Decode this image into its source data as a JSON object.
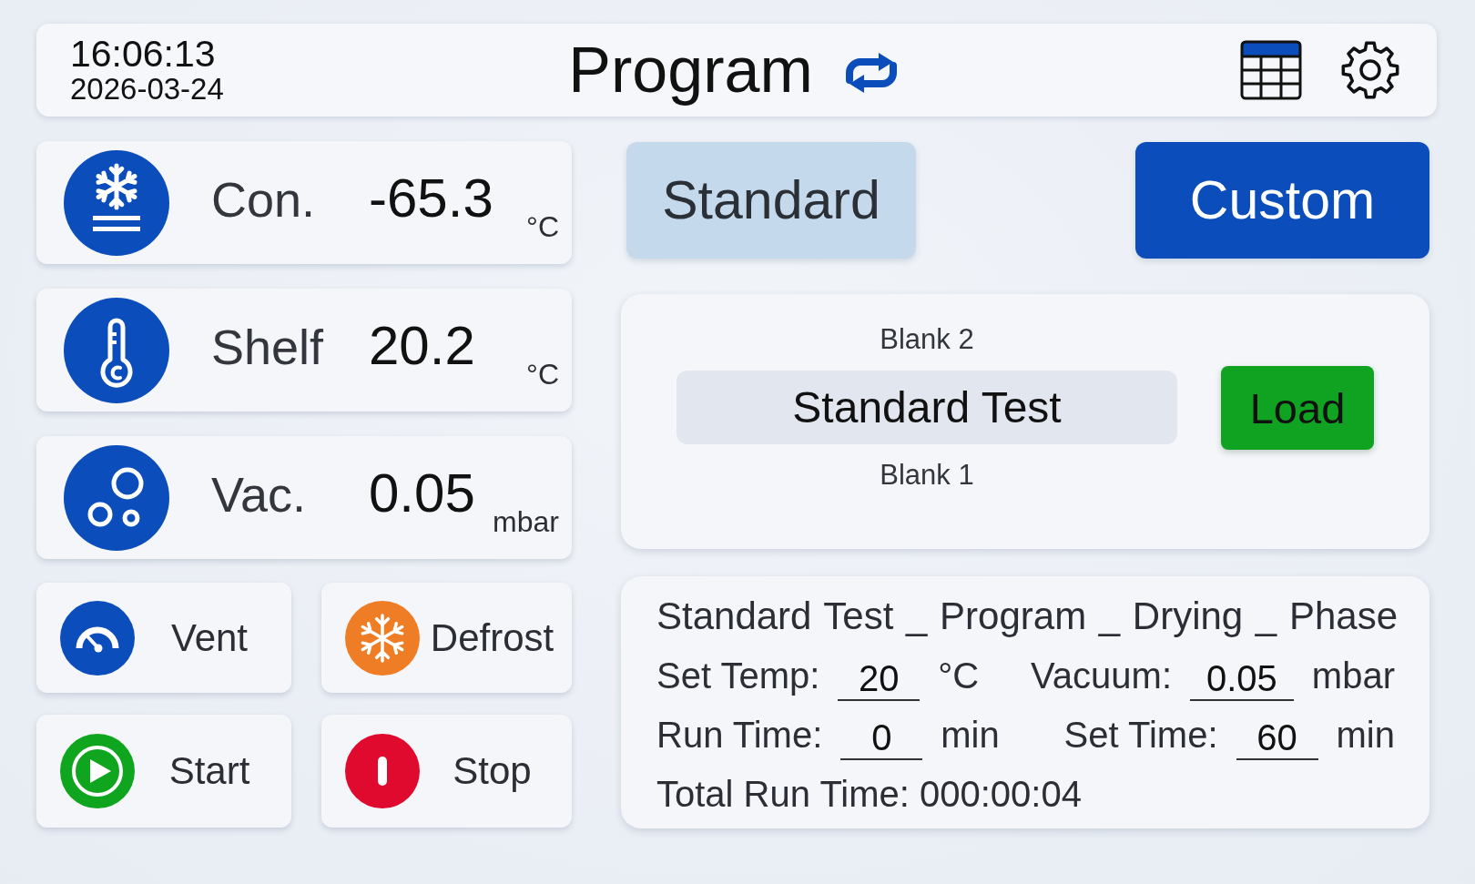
{
  "header": {
    "time": "16:06:13",
    "date": "2026-03-24",
    "title": "Program"
  },
  "sensors": [
    {
      "kind": "condenser",
      "label": "Con.",
      "value": "-65.3",
      "unit": "°C"
    },
    {
      "kind": "shelf",
      "label": "Shelf",
      "value": "20.2",
      "unit": "°C"
    },
    {
      "kind": "vacuum",
      "label": "Vac.",
      "value": "0.05",
      "unit": "mbar"
    }
  ],
  "actions": [
    {
      "kind": "vent",
      "label": "Vent",
      "color": "#0b4dbb"
    },
    {
      "kind": "defrost",
      "label": "Defrost",
      "color": "#ee7d25"
    },
    {
      "kind": "start",
      "label": "Start",
      "color": "#10a51f"
    },
    {
      "kind": "stop",
      "label": "Stop",
      "color": "#e0092e"
    }
  ],
  "mode_tabs": [
    {
      "label": "Standard",
      "selected": false
    },
    {
      "label": "Custom",
      "selected": true
    }
  ],
  "program_list": {
    "items": [
      {
        "label": "Blank 2",
        "selected": false
      },
      {
        "label": "Standard Test",
        "selected": true
      },
      {
        "label": "Blank 1",
        "selected": false
      }
    ],
    "load_button": "Load"
  },
  "status": {
    "title": "Standard Test _ Program _ Drying _ Phase",
    "rows": [
      [
        {
          "label": "Set Temp:",
          "value": "20",
          "unit": "°C"
        },
        {
          "label": "Vacuum:",
          "value": "0.05",
          "unit": "mbar"
        }
      ],
      [
        {
          "label": "Run Time:",
          "value": "0",
          "unit": "min"
        },
        {
          "label": "Set Time:",
          "value": "60",
          "unit": "min"
        }
      ]
    ],
    "total": "Total Run Time: 000:00:04"
  }
}
